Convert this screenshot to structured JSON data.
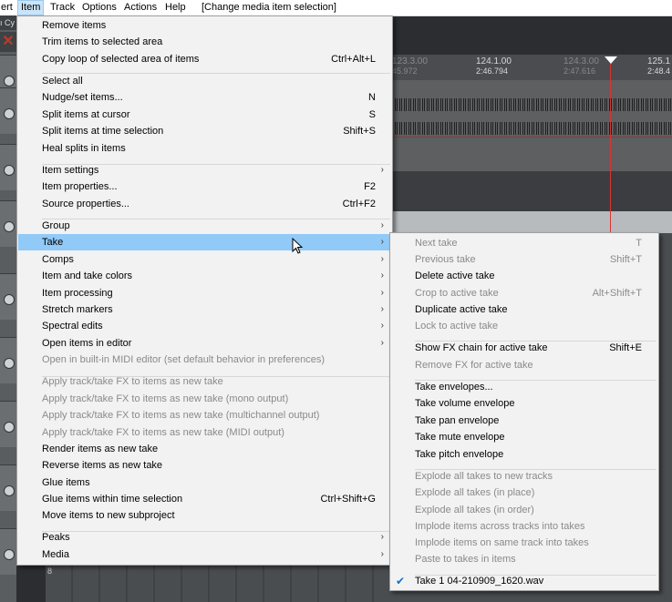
{
  "menubar": {
    "items": [
      {
        "label": "ert"
      },
      {
        "label": "Item"
      },
      {
        "label": "Track"
      },
      {
        "label": "Options"
      },
      {
        "label": "Actions"
      },
      {
        "label": "Help"
      },
      {
        "label": "[Change media item selection]"
      }
    ]
  },
  "background": {
    "tcp_top_text": "ı Cy",
    "ruler": [
      {
        "bar": "123.3.00",
        "time": "45.972"
      },
      {
        "bar": "124.1.00",
        "time": "2:46.794"
      },
      {
        "bar": "124.3.00",
        "time": "2:47.616"
      },
      {
        "bar": "125.1",
        "time": "2:48.4"
      }
    ],
    "bottom_track_number": "8"
  },
  "item_menu": {
    "items": [
      {
        "label": "Remove items",
        "shortcut": "",
        "submenu": false,
        "disabled": false
      },
      {
        "label": "Trim items to selected area",
        "shortcut": "",
        "submenu": false,
        "disabled": false
      },
      {
        "label": "Copy loop of selected area of items",
        "shortcut": "Ctrl+Alt+L",
        "submenu": false,
        "disabled": false
      },
      {
        "label": "Select all",
        "shortcut": "",
        "submenu": false,
        "disabled": false
      },
      {
        "label": "Nudge/set items...",
        "shortcut": "N",
        "submenu": false,
        "disabled": false
      },
      {
        "label": "Split items at cursor",
        "shortcut": "S",
        "submenu": false,
        "disabled": false
      },
      {
        "label": "Split items at time selection",
        "shortcut": "Shift+S",
        "submenu": false,
        "disabled": false
      },
      {
        "label": "Heal splits in items",
        "shortcut": "",
        "submenu": false,
        "disabled": false
      },
      {
        "label": "Item settings",
        "shortcut": "",
        "submenu": true,
        "disabled": false
      },
      {
        "label": "Item properties...",
        "shortcut": "F2",
        "submenu": false,
        "disabled": false
      },
      {
        "label": "Source properties...",
        "shortcut": "Ctrl+F2",
        "submenu": false,
        "disabled": false
      },
      {
        "label": "Group",
        "shortcut": "",
        "submenu": true,
        "disabled": false
      },
      {
        "label": "Take",
        "shortcut": "",
        "submenu": true,
        "disabled": false,
        "highlighted": true
      },
      {
        "label": "Comps",
        "shortcut": "",
        "submenu": true,
        "disabled": false
      },
      {
        "label": "Item and take colors",
        "shortcut": "",
        "submenu": true,
        "disabled": false
      },
      {
        "label": "Item processing",
        "shortcut": "",
        "submenu": true,
        "disabled": false
      },
      {
        "label": "Stretch markers",
        "shortcut": "",
        "submenu": true,
        "disabled": false
      },
      {
        "label": "Spectral edits",
        "shortcut": "",
        "submenu": true,
        "disabled": false
      },
      {
        "label": "Open items in editor",
        "shortcut": "",
        "submenu": true,
        "disabled": false
      },
      {
        "label": "Open in built-in MIDI editor (set default behavior in preferences)",
        "shortcut": "",
        "submenu": false,
        "disabled": true
      },
      {
        "label": "Apply track/take FX to items as new take",
        "shortcut": "",
        "submenu": false,
        "disabled": true
      },
      {
        "label": "Apply track/take FX to items as new take (mono output)",
        "shortcut": "",
        "submenu": false,
        "disabled": true
      },
      {
        "label": "Apply track/take FX to items as new take (multichannel output)",
        "shortcut": "",
        "submenu": false,
        "disabled": true
      },
      {
        "label": "Apply track/take FX to items as new take (MIDI output)",
        "shortcut": "",
        "submenu": false,
        "disabled": true
      },
      {
        "label": "Render items as new take",
        "shortcut": "",
        "submenu": false,
        "disabled": false
      },
      {
        "label": "Reverse items as new take",
        "shortcut": "",
        "submenu": false,
        "disabled": false
      },
      {
        "label": "Glue items",
        "shortcut": "",
        "submenu": false,
        "disabled": false
      },
      {
        "label": "Glue items within time selection",
        "shortcut": "Ctrl+Shift+G",
        "submenu": false,
        "disabled": false
      },
      {
        "label": "Move items to new subproject",
        "shortcut": "",
        "submenu": false,
        "disabled": false
      },
      {
        "label": "Peaks",
        "shortcut": "",
        "submenu": true,
        "disabled": false
      },
      {
        "label": "Media",
        "shortcut": "",
        "submenu": true,
        "disabled": false
      }
    ]
  },
  "take_menu": {
    "items": [
      {
        "label": "Next take",
        "shortcut": "T",
        "disabled": true
      },
      {
        "label": "Previous take",
        "shortcut": "Shift+T",
        "disabled": true
      },
      {
        "label": "Delete active take",
        "shortcut": "",
        "disabled": false
      },
      {
        "label": "Crop to active take",
        "shortcut": "Alt+Shift+T",
        "disabled": true
      },
      {
        "label": "Duplicate active take",
        "shortcut": "",
        "disabled": false
      },
      {
        "label": "Lock to active take",
        "shortcut": "",
        "disabled": true
      },
      {
        "label": "Show FX chain for active take",
        "shortcut": "Shift+E",
        "disabled": false
      },
      {
        "label": "Remove FX for active take",
        "shortcut": "",
        "disabled": true
      },
      {
        "label": "Take envelopes...",
        "shortcut": "",
        "disabled": false
      },
      {
        "label": "Take volume envelope",
        "shortcut": "",
        "disabled": false
      },
      {
        "label": "Take pan envelope",
        "shortcut": "",
        "disabled": false
      },
      {
        "label": "Take mute envelope",
        "shortcut": "",
        "disabled": false
      },
      {
        "label": "Take pitch envelope",
        "shortcut": "",
        "disabled": false
      },
      {
        "label": "Explode all takes to new tracks",
        "shortcut": "",
        "disabled": true
      },
      {
        "label": "Explode all takes (in place)",
        "shortcut": "",
        "disabled": true
      },
      {
        "label": "Explode all takes (in order)",
        "shortcut": "",
        "disabled": true
      },
      {
        "label": "Implode items across tracks into takes",
        "shortcut": "",
        "disabled": true
      },
      {
        "label": "Implode items on same track into takes",
        "shortcut": "",
        "disabled": true
      },
      {
        "label": "Paste to takes in items",
        "shortcut": "",
        "disabled": true
      },
      {
        "label": "Take 1 04-210909_1620.wav",
        "shortcut": "",
        "disabled": false,
        "checked": true
      }
    ]
  },
  "colors": {
    "highlight": "#91c9f7",
    "menu_bg": "#f2f2f2",
    "disabled_text": "#8a8a8a",
    "check": "#1a6fc7"
  }
}
